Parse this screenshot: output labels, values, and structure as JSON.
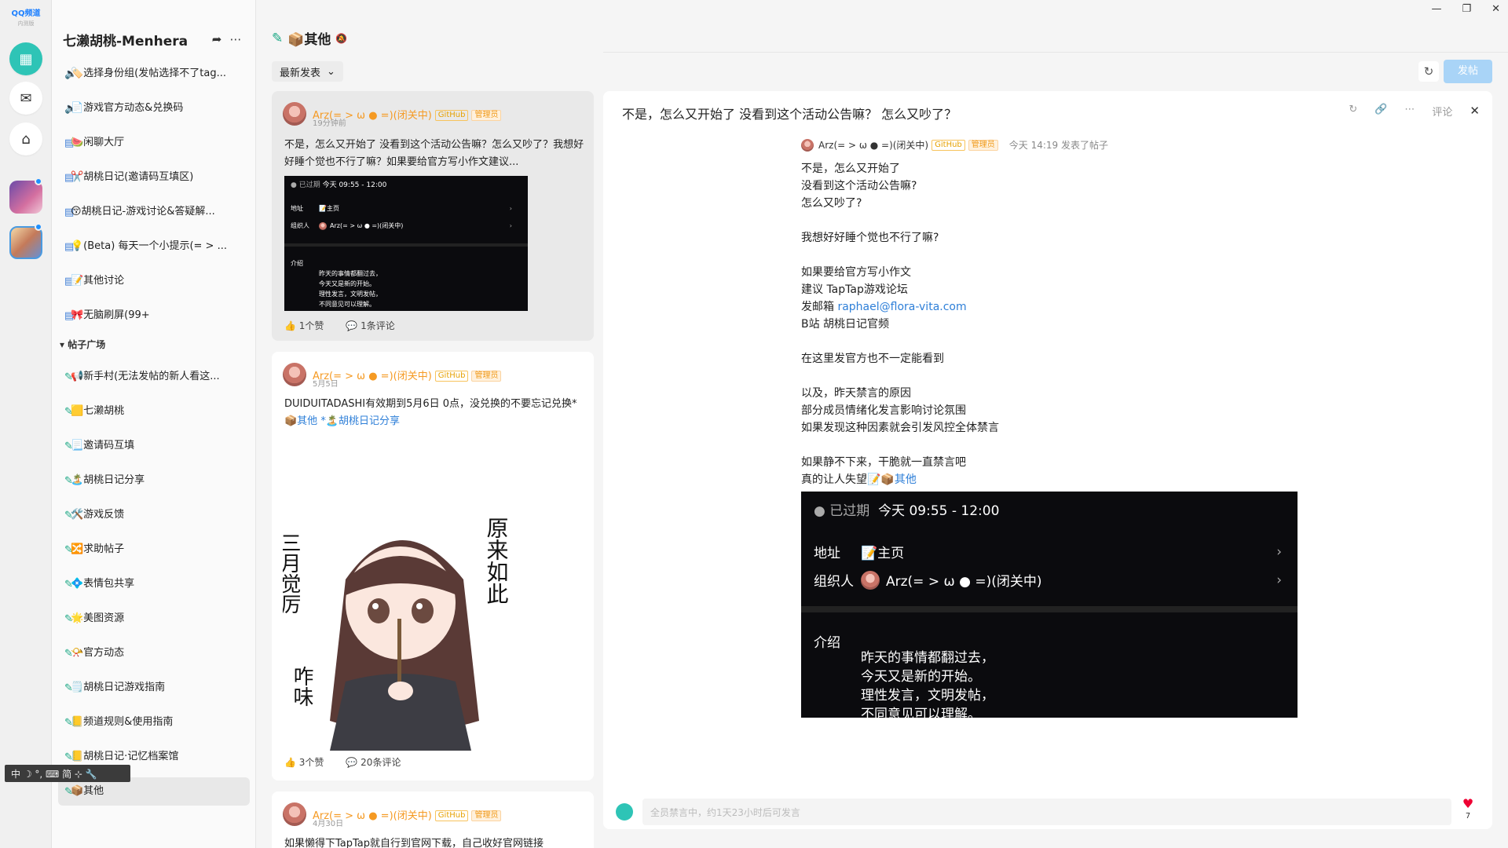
{
  "app": {
    "logo": "QQ频道",
    "logo_sub": "内测版"
  },
  "guild": {
    "name": "七濑胡桃-Menhera"
  },
  "channels_top": [
    {
      "icon": "📢",
      "label": "🏷️选择身份组(发帖选择不了tag..."
    },
    {
      "icon": "📢",
      "label": "📄游戏官方动态&兑换码"
    },
    {
      "icon": "💬",
      "label": "🍉闲聊大厅"
    },
    {
      "icon": "💬",
      "label": "✂️胡桃日记(邀请码互填区)"
    },
    {
      "icon": "💬",
      "label": "😚胡桃日记-游戏讨论&答疑解..."
    },
    {
      "icon": "💬",
      "label": "💡(Beta) 每天一个小提示(= > ..."
    },
    {
      "icon": "💬",
      "label": "📝其他讨论"
    },
    {
      "icon": "💬",
      "label": "🎀无脑刷屏(99+"
    }
  ],
  "section": {
    "label": "帖子广场"
  },
  "channels_forum": [
    {
      "label": "📢新手村(无法发帖的新人看这..."
    },
    {
      "label": "🟨七濑胡桃"
    },
    {
      "label": "📃邀请码互填"
    },
    {
      "label": "🏝️胡桃日记分享"
    },
    {
      "label": "🛠️游戏反馈"
    },
    {
      "label": "🔀求助帖子"
    },
    {
      "label": "💠表情包共享"
    },
    {
      "label": "🌟美图资源"
    },
    {
      "label": "📯官方动态"
    },
    {
      "label": "🗒️胡桃日记游戏指南"
    },
    {
      "label": "📒频道规则&使用指南"
    },
    {
      "label": "📒胡桃日记·记忆档案馆"
    },
    {
      "label": "📦其他"
    }
  ],
  "ime": {
    "text": "中 ☽ °, ⌨ 简 ⊹ 🔧"
  },
  "list": {
    "title": "📦其他",
    "sort": "最新发表",
    "posts": [
      {
        "author": "Arz(= > ω ● =)(闭关中)",
        "badge1": "GitHub",
        "badge2": "管理员",
        "time": "19分钟前",
        "text": "不是，怎么又开始了 没看到这个活动公告嘛？怎么又吵了？我想好好睡个觉也不行了嘛？如果要给官方写小作文建议...",
        "likes": "1个赞",
        "comments": "1条评论"
      },
      {
        "author": "Arz(= > ω ● =)(闭关中)",
        "badge1": "GitHub",
        "badge2": "管理员",
        "time": "5月5日",
        "text": "DUIDUITADASHI有效期到5月6日 0点，没兑换的不要忘记兑换*",
        "link1": "📦其他",
        "link2": "*🏝️胡桃日记分享",
        "likes": "3个赞",
        "comments": "20条评论"
      },
      {
        "author": "Arz(= > ω ● =)(闭关中)",
        "badge1": "GitHub",
        "badge2": "管理员",
        "time": "4月30日",
        "text": "如果懒得下TapTap就自行到官网下载，自己收好官网链接"
      }
    ]
  },
  "event_small": {
    "expired": "● 已过期",
    "time": "今天 09:55 - 12:00",
    "addr_label": "地址",
    "addr_value": "📝主页",
    "org_label": "组织人",
    "org_value": "Arz(= > ω ● =)(闭关中)",
    "intro_label": "介绍",
    "intro_lines": [
      "昨天的事情都翻过去，",
      "今天又是新的开始。",
      "理性发言，文明发帖，",
      "不同意见可以理解。"
    ]
  },
  "sticker": {
    "left_text": "三月觉厉",
    "right_text": "原来如此",
    "bottom_text": "咋味"
  },
  "detail": {
    "title": "不是，怎么又开始了 没看到这个活动公告嘛？ 怎么又吵了？",
    "tools": {
      "comment": "评论"
    },
    "author": "Arz(= > ω ● =)(闭关中)",
    "badge1": "GitHub",
    "badge2": "管理员",
    "time": "今天 14:19 发表了帖子",
    "body1": "不是，怎么又开始了\n没看到这个活动公告嘛?\n怎么又吵了?\n\n我想好好睡个觉也不行了嘛?\n\n如果要给官方写小作文\n建议 TapTap游戏论坛",
    "email_prefix": "发邮箱 ",
    "email": "raphael@flora-vita.com",
    "body2": "B站 胡桃日记官频\n\n在这里发官方也不一定能看到\n\n以及，昨天禁言的原因\n部分成员情绪化发言影响讨论氛围\n如果发现这种因素就会引发风控全体禁言\n\n如果静不下来，干脆就一直禁言吧",
    "body3_prefix": "真的让人失望",
    "body3_link": "📝📦其他",
    "input_placeholder": "全员禁言中，约1天23小时后可发言",
    "heart_count": "7"
  },
  "top": {
    "post_button": "发帖"
  }
}
